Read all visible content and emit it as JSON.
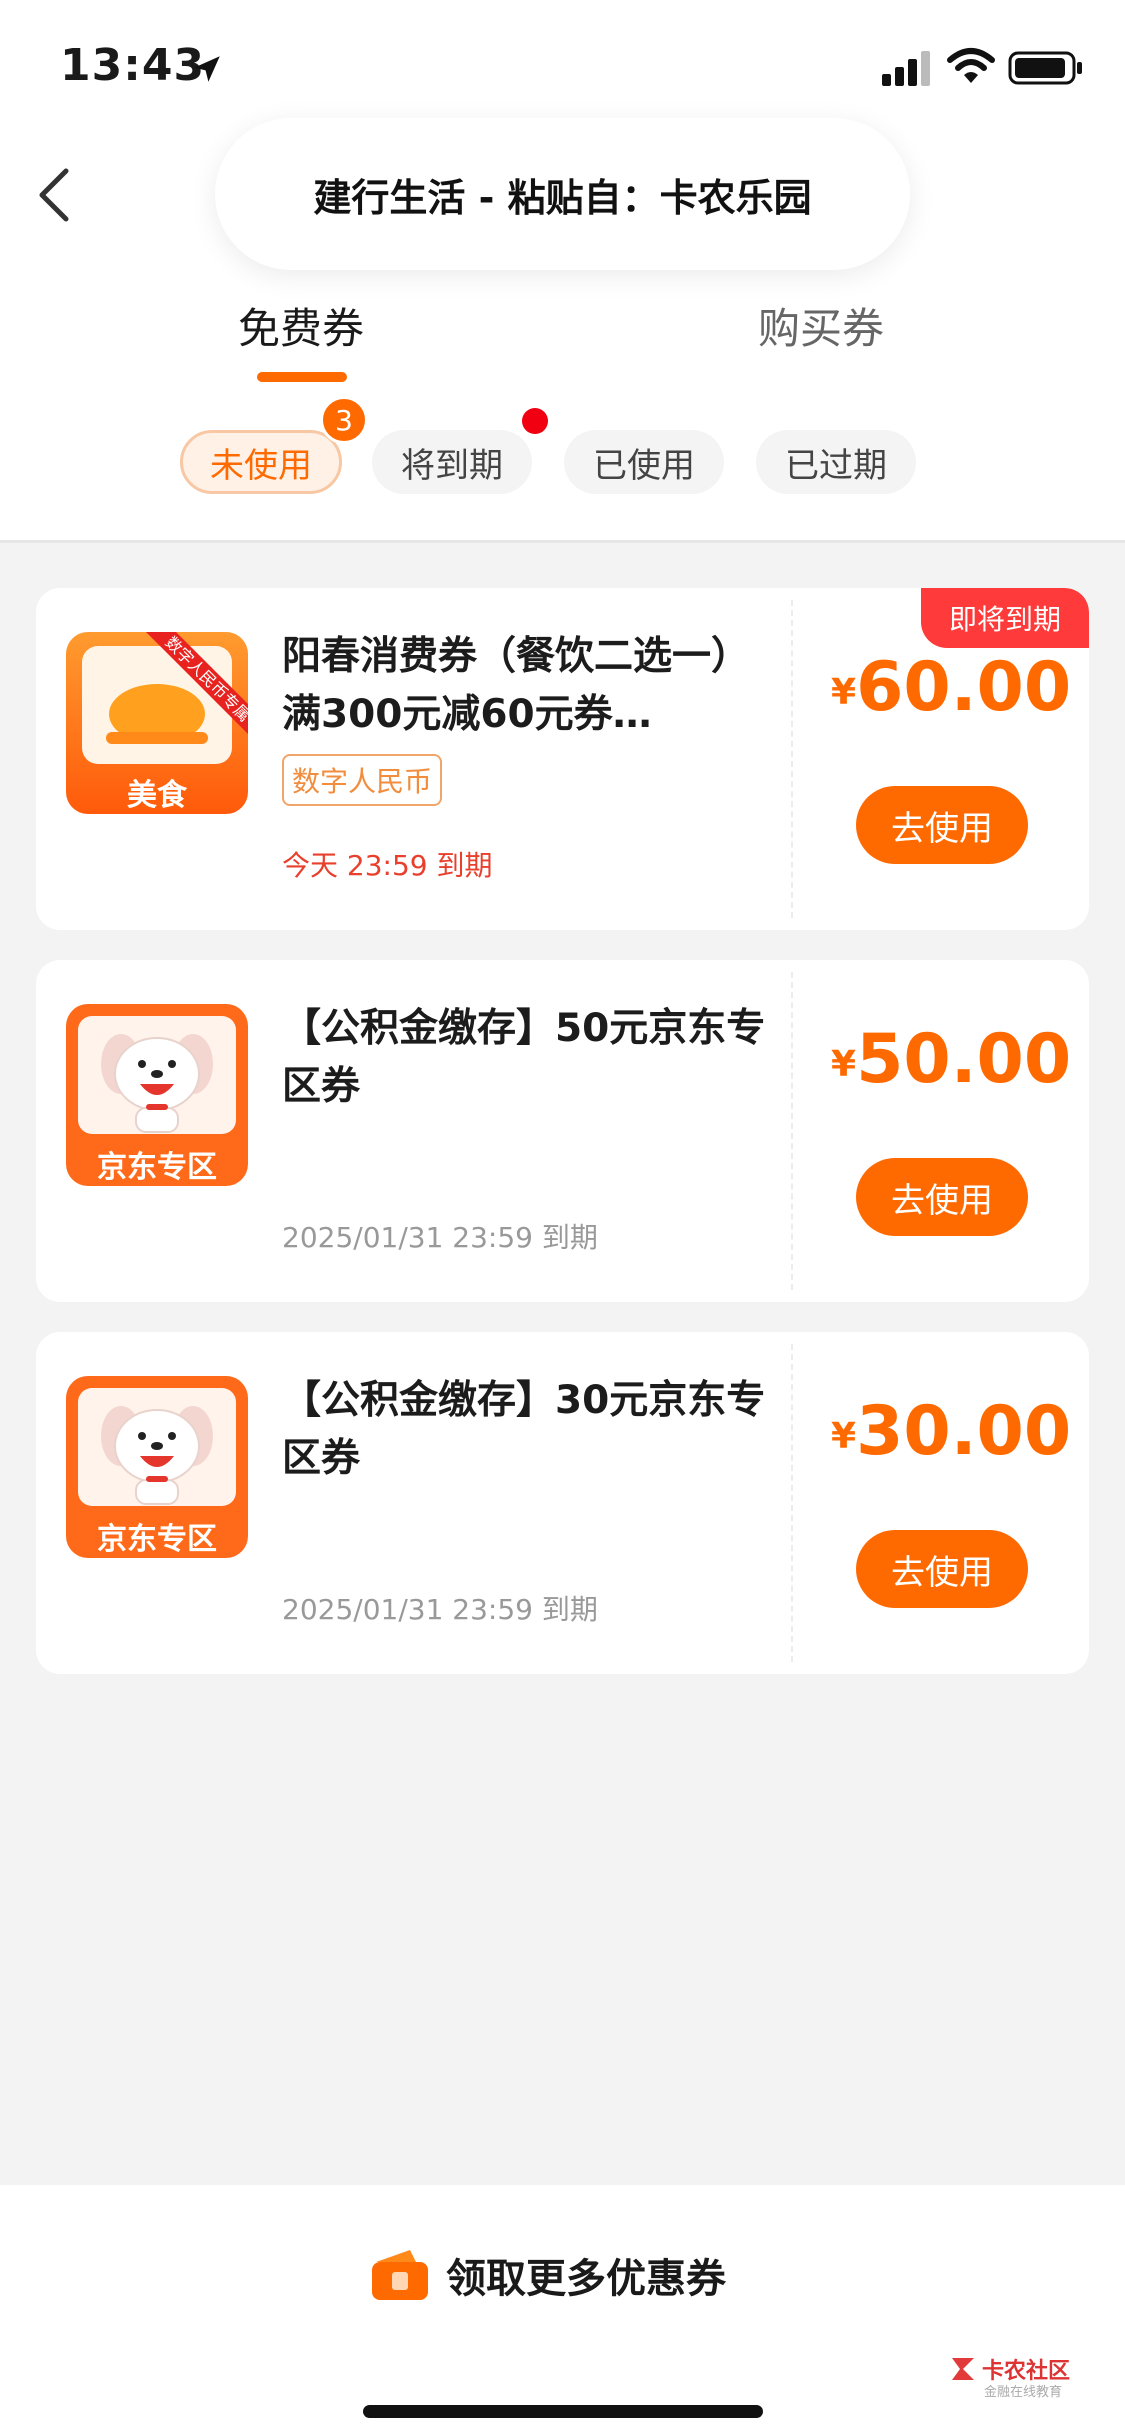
{
  "status": {
    "time": "13:43"
  },
  "header": {
    "title": "建行生活 - 粘贴自：卡农乐园"
  },
  "tabs": {
    "free": "免费券",
    "buy": "购买券",
    "active": "免费券"
  },
  "filters": {
    "unused": "未使用",
    "expiring": "将到期",
    "used": "已使用",
    "expired": "已过期",
    "unused_count": "3"
  },
  "coupons": [
    {
      "thumb_label": "美食",
      "thumb_ribbon": "数字人民币专属",
      "title": "阳春消费券（餐饮二选一）满300元减60元券…",
      "tag": "数字人民币",
      "expiry": "今天 23:59 到期",
      "currency": "¥",
      "amount": "60.00",
      "button": "去使用",
      "badge": "即将到期"
    },
    {
      "thumb_label": "京东专区",
      "title": "【公积金缴存】50元京东专区券",
      "expiry": "2025/01/31 23:59 到期",
      "currency": "¥",
      "amount": "50.00",
      "button": "去使用"
    },
    {
      "thumb_label": "京东专区",
      "title": "【公积金缴存】30元京东专区券",
      "expiry": "2025/01/31 23:59 到期",
      "currency": "¥",
      "amount": "30.00",
      "button": "去使用"
    }
  ],
  "footer": {
    "more_label": "领取更多优惠券",
    "watermark_name": "卡农社区",
    "watermark_sub": "金融在线教育"
  },
  "icons": {
    "back": "back-chevron-icon",
    "location": "location-arrow-icon",
    "signal": "cellular-signal-icon",
    "wifi": "wifi-icon",
    "battery": "battery-icon",
    "more": "coupon-ticket-icon",
    "food": "food-dish-icon",
    "jd_mascot": "jd-dog-icon"
  },
  "colors": {
    "accent": "#ff6a00",
    "danger": "#ff3a3a",
    "tag_border": "#f0a56b"
  }
}
